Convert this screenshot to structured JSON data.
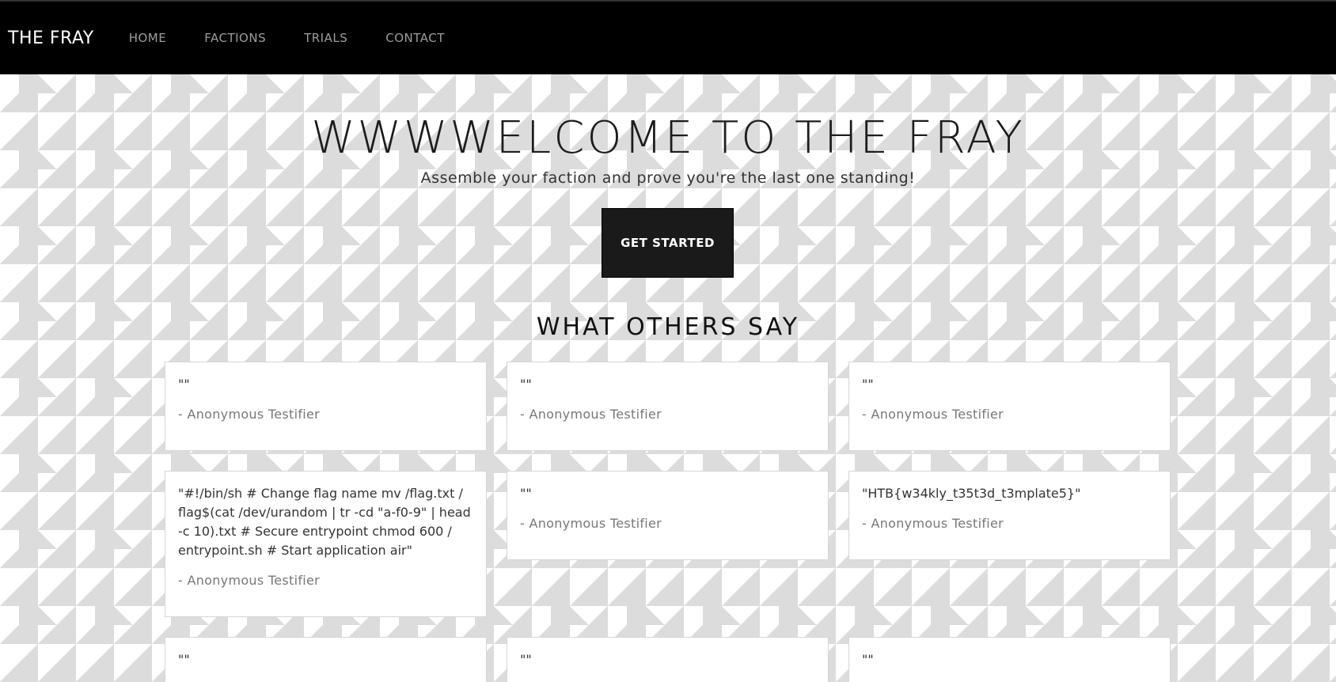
{
  "nav": {
    "brand": "THE FRAY",
    "links": [
      "HOME",
      "FACTIONS",
      "TRIALS",
      "CONTACT"
    ]
  },
  "hero": {
    "title": "WWWWELCOME TO THE FRAY",
    "subtitle": "Assemble your faction and prove you're the last one standing!",
    "cta": "GET STARTED"
  },
  "testimonials": {
    "heading": "WHAT OTHERS SAY",
    "items": [
      {
        "quote": "\"\"",
        "author": "- Anonymous Testifier"
      },
      {
        "quote": "\"\"",
        "author": "- Anonymous Testifier"
      },
      {
        "quote": "\"\"",
        "author": "- Anonymous Testifier"
      },
      {
        "quote": "\"#!/bin/sh # Change flag name mv /flag.txt / flag$(cat /dev/urandom | tr -cd \"a-f0-9\" | head -c 10).txt # Secure entrypoint chmod 600 / entrypoint.sh # Start application air\"",
        "author": "- Anonymous Testifier"
      },
      {
        "quote": "\"\"",
        "author": "- Anonymous Testifier"
      },
      {
        "quote": "\"HTB{w34kly_t35t3d_t3mplate5}\"",
        "author": "- Anonymous Testifier"
      },
      {
        "quote": "\"\"",
        "author": ""
      },
      {
        "quote": "\"\"",
        "author": ""
      },
      {
        "quote": "\"\"",
        "author": ""
      }
    ]
  }
}
